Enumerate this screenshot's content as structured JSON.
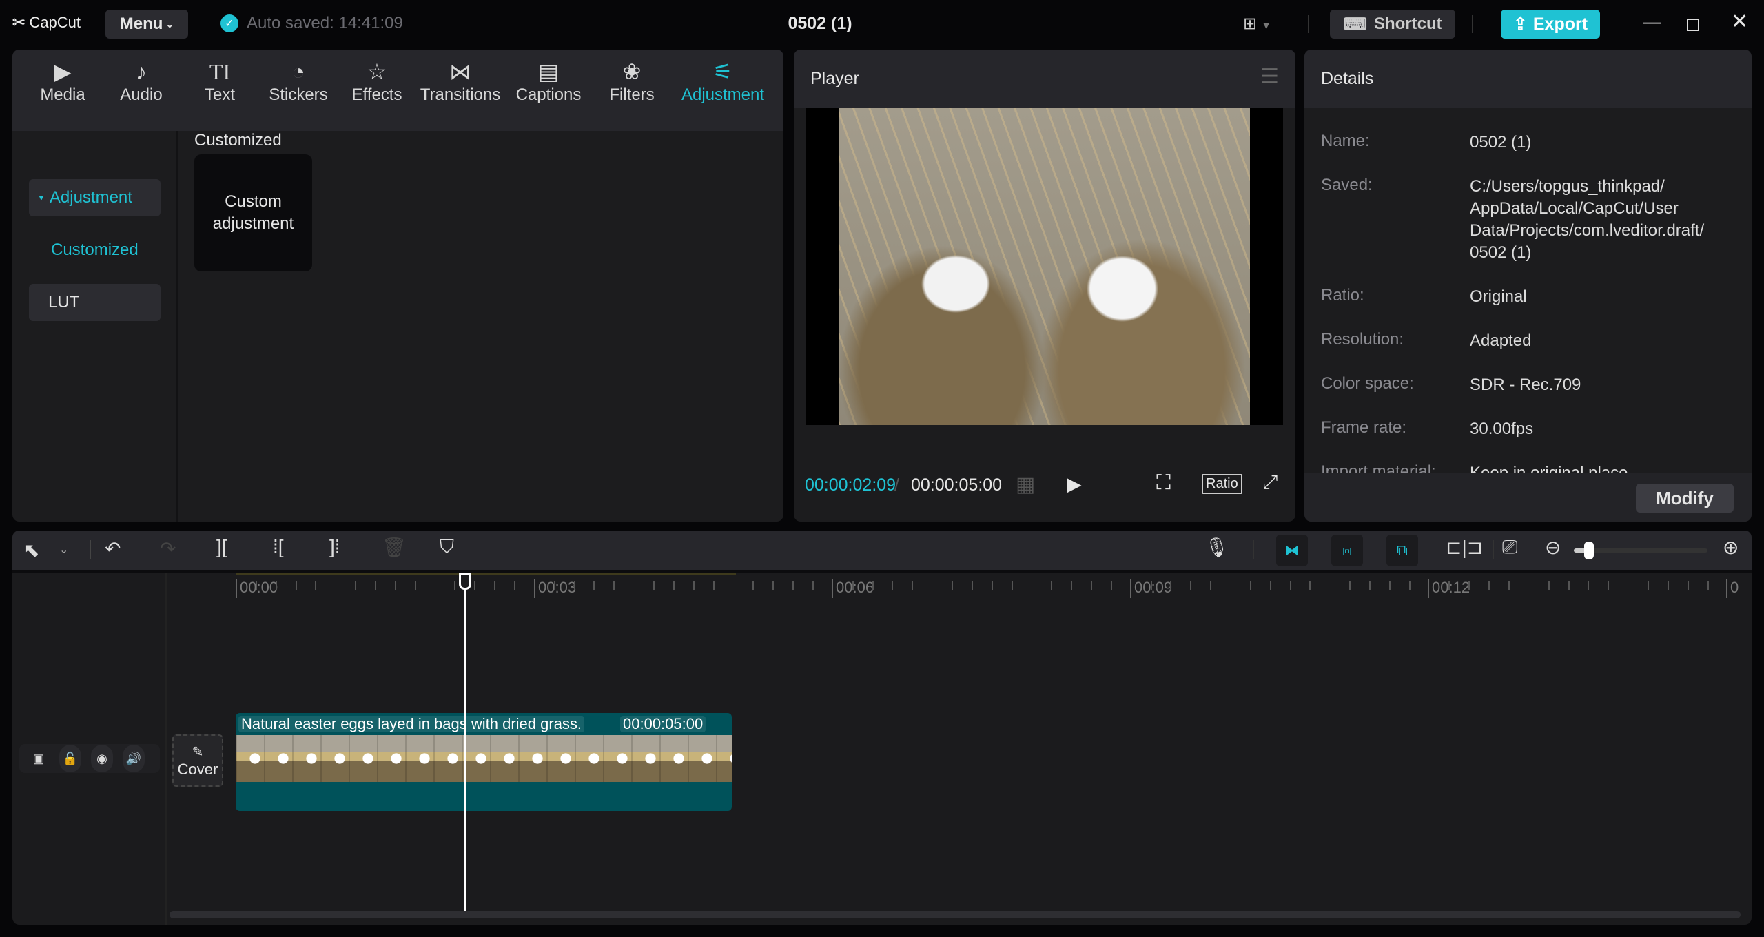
{
  "titlebar": {
    "logo": "CapCut",
    "menu": "Menu",
    "autosave": "Auto saved: 14:41:09",
    "project_title": "0502 (1)",
    "shortcut": "Shortcut",
    "export": "Export"
  },
  "tabs": [
    {
      "label": "Media",
      "icon": "▶"
    },
    {
      "label": "Audio",
      "icon": "♪"
    },
    {
      "label": "Text",
      "icon": "TI"
    },
    {
      "label": "Stickers",
      "icon": "◔"
    },
    {
      "label": "Effects",
      "icon": "☆"
    },
    {
      "label": "Transitions",
      "icon": "⋈"
    },
    {
      "label": "Captions",
      "icon": "▤"
    },
    {
      "label": "Filters",
      "icon": "❀"
    },
    {
      "label": "Adjustment",
      "icon": "⚟"
    }
  ],
  "sidebar": {
    "adjustment": "Adjustment",
    "customized": "Customized",
    "lut": "LUT"
  },
  "content": {
    "section": "Customized",
    "card": "Custom adjustment"
  },
  "player": {
    "title": "Player",
    "current": "00:00:02:09",
    "total": "00:00:05:00",
    "ratio": "Ratio"
  },
  "details": {
    "title": "Details",
    "rows": [
      {
        "label": "Name:",
        "value": "0502 (1)"
      },
      {
        "label": "Saved:",
        "value": "C:/Users/topgus_thinkpad/ AppData/Local/CapCut/User Data/Projects/com.lveditor.draft/ 0502 (1)"
      },
      {
        "label": "Ratio:",
        "value": "Original"
      },
      {
        "label": "Resolution:",
        "value": "Adapted"
      },
      {
        "label": "Color space:",
        "value": "SDR - Rec.709"
      },
      {
        "label": "Frame rate:",
        "value": "30.00fps"
      },
      {
        "label": "Import material:",
        "value": "Keep in original place"
      }
    ],
    "modify": "Modify"
  },
  "timeline": {
    "ruler": [
      "00:00",
      "00:03",
      "00:06",
      "00:09",
      "00:12",
      "0"
    ],
    "cover": "Cover",
    "clip_name": "Natural easter eggs layed in bags with dried grass.",
    "clip_duration": "00:00:05:00",
    "playhead_seconds": 2.3,
    "zoom_level": 0.1
  },
  "colors": {
    "accent": "#1fc2d3",
    "clip": "#00525a"
  }
}
